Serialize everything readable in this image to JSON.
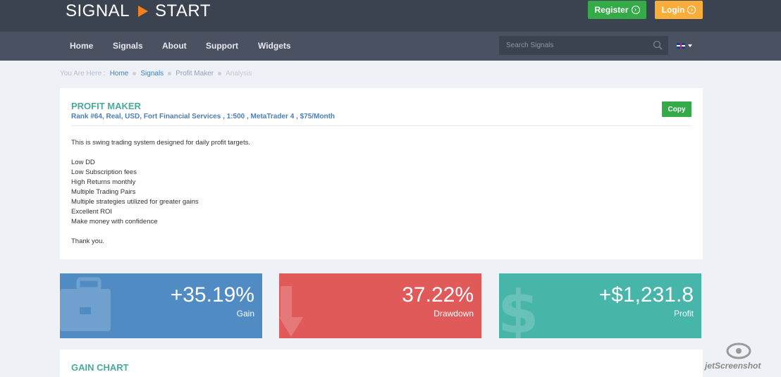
{
  "header": {
    "logo_left": "SIGNAL",
    "logo_right": "START",
    "register_label": "Register",
    "login_label": "Login"
  },
  "nav": {
    "items": [
      "Home",
      "Signals",
      "About",
      "Support",
      "Widgets"
    ],
    "search_placeholder": "Search Signals"
  },
  "breadcrumb": {
    "prefix": "You Are Here :",
    "items": [
      "Home",
      "Signals",
      "Profit Maker",
      "Analysis"
    ]
  },
  "signal": {
    "title": "PROFIT MAKER",
    "subtitle": "Rank #64, Real, USD, Fort Financial Services , 1:500 , MetaTrader 4 , $75/Month",
    "copy_label": "Copy",
    "description": [
      "This is swing trading system designed for daily profit targets.",
      "",
      "Low DD",
      "Low Subscription fees",
      "High Returns monthly",
      "Multiple Trading Pairs",
      "Multiple strategies utilized for greater gains",
      "Excellent ROI",
      "Make money with confidence",
      "",
      "Thank you."
    ]
  },
  "stats": {
    "gain": {
      "value": "+35.19%",
      "label": "Gain",
      "color": "#508cc3",
      "icon": "briefcase-icon"
    },
    "drawdown": {
      "value": "37.22%",
      "label": "Drawdown",
      "color": "#e05a5a",
      "icon": "down-arrow-icon"
    },
    "profit": {
      "value": "+$1,231.8",
      "label": "Profit",
      "color": "#47b5aa",
      "icon": "dollar-icon"
    }
  },
  "gain_chart": {
    "title": "GAIN CHART"
  },
  "watermark": {
    "text": "jetScreenshot"
  },
  "colors": {
    "topbar": "#3c4350",
    "navbar": "#4a5262",
    "accent_teal": "#4aab9b",
    "register_green": "#35aa48",
    "login_orange": "#f9ad3a"
  }
}
